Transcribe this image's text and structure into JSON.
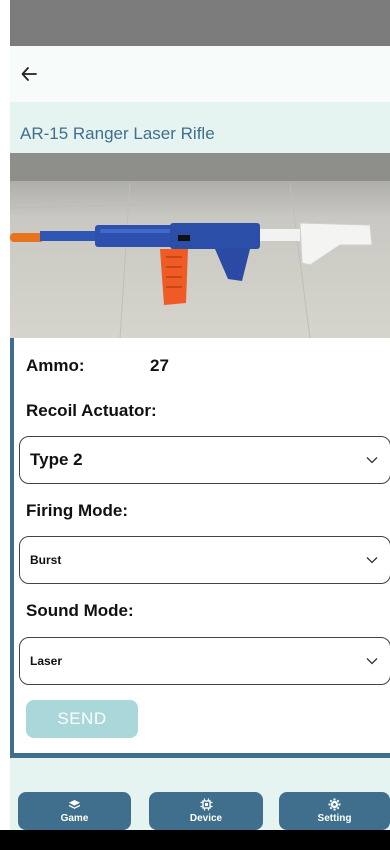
{
  "app_bar": {
    "back_icon": "arrow-left-icon"
  },
  "product": {
    "title": "AR-15 Ranger Laser Rifle"
  },
  "form": {
    "ammo_label": "Ammo:",
    "ammo_value": "27",
    "recoil_label": "Recoil Actuator:",
    "recoil_value": "Type 2",
    "firing_label": "Firing Mode:",
    "firing_value": "Burst",
    "sound_label": "Sound Mode:",
    "sound_value": "Laser",
    "send_label": "SEND"
  },
  "nav": {
    "game": {
      "label": "Game",
      "icon": "layers-icon"
    },
    "device": {
      "label": "Device",
      "icon": "chip-icon"
    },
    "setting": {
      "label": "Setting",
      "icon": "gear-icon"
    }
  },
  "colors": {
    "accent": "#3f6f8c",
    "send_button": "#a9d7da",
    "background": "#e6f4f1"
  }
}
